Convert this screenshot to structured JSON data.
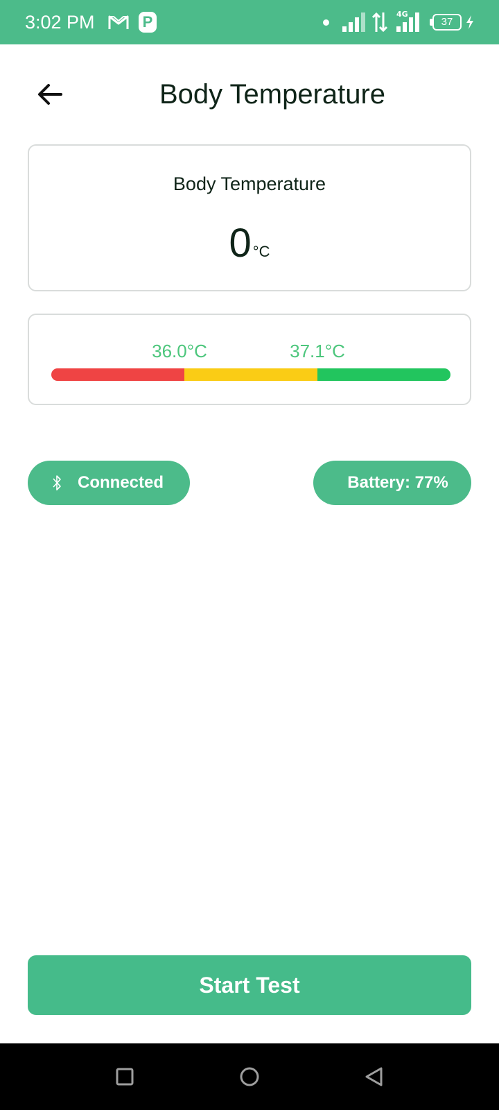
{
  "status_bar": {
    "time": "3:02 PM",
    "p_icon_text": "P",
    "battery_level": "37",
    "icons": [
      "gmail-icon",
      "p-notification-icon",
      "dot-icon",
      "signal-icon",
      "data-arrows-icon",
      "signal-4g-icon",
      "battery-icon",
      "charging-bolt-icon"
    ],
    "background_color": "#4cbb8a"
  },
  "header": {
    "title": "Body Temperature",
    "back_icon": "arrow-left-icon"
  },
  "reading": {
    "label": "Body Temperature",
    "value": "0",
    "unit": "°C"
  },
  "range": {
    "thresholds": [
      {
        "label": "36.0°C",
        "value": 36.0
      },
      {
        "label": "37.1°C",
        "value": 37.1
      }
    ],
    "segments": [
      {
        "name": "low",
        "color": "#ef4444",
        "fraction": 0.333
      },
      {
        "name": "mid",
        "color": "#facc15",
        "fraction": 0.333
      },
      {
        "name": "normal",
        "color": "#22c55e",
        "fraction": 0.334
      }
    ]
  },
  "status": {
    "connection_label": "Connected",
    "connection_icon": "bluetooth-icon",
    "battery_label": "Battery: 77%"
  },
  "actions": {
    "start_label": "Start Test"
  },
  "nav": {
    "icons": [
      "recents-square-icon",
      "home-circle-icon",
      "back-triangle-icon"
    ]
  },
  "colors": {
    "accent": "#4cbb8a",
    "threshold_text": "#4cc67c",
    "text_dark": "#0f2418"
  }
}
